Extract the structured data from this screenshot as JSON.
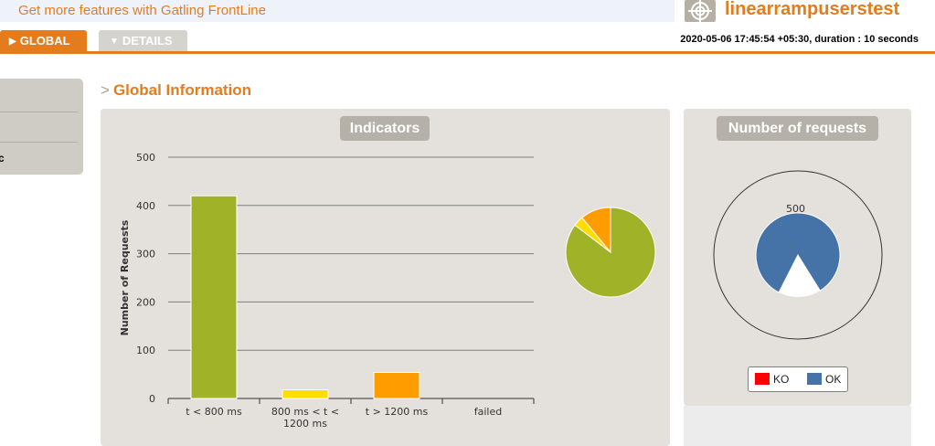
{
  "banner": {
    "text": "Get more features with Gatling FrontLine"
  },
  "header": {
    "logo_icon": "target-icon",
    "simulation_name": "linearrampuserstest",
    "run_info": "2020-05-06 17:45:54 +05:30, duration : 10 seconds"
  },
  "tabs": [
    {
      "label": "GLOBAL",
      "icon": "caret-right-icon",
      "active": true
    },
    {
      "label": "DETAILS",
      "icon": "caret-down-icon",
      "active": false
    }
  ],
  "sidebar": {
    "items": [
      "",
      "",
      "c"
    ]
  },
  "section": {
    "title": "Global Information",
    "marker": ">"
  },
  "indicators": {
    "title": "Indicators",
    "chart_data": {
      "type": "bar",
      "title": "",
      "ylabel": "Number of Requests",
      "xlabel": "",
      "ylim": [
        0,
        500
      ],
      "yticks": [
        "0",
        "100",
        "200",
        "300",
        "400",
        "500"
      ],
      "categories": [
        "t < 800 ms",
        "800 ms < t < 1200 ms",
        "t > 1200 ms",
        "failed"
      ],
      "values": [
        420,
        18,
        54,
        0
      ],
      "colors": [
        "#a0b228",
        "#ffdd00",
        "#ff9d00",
        "#f15b4f"
      ],
      "grid": true
    },
    "pie": {
      "type": "pie",
      "values": [
        420,
        18,
        54,
        0
      ],
      "colors": [
        "#a0b228",
        "#ffdd00",
        "#ff9d00",
        "#f15b4f"
      ]
    }
  },
  "requests": {
    "title": "Number of requests",
    "chart_data": {
      "type": "gauge",
      "series": [
        {
          "name": "OK",
          "value": 492,
          "color": "#4572a7"
        },
        {
          "name": "KO",
          "value": 0,
          "color": "#ff0000"
        }
      ],
      "max": 500,
      "tick_labels": [
        "500",
        "0"
      ]
    },
    "legend": [
      {
        "label": "KO",
        "color": "#ff0000"
      },
      {
        "label": "OK",
        "color": "#4572a7"
      }
    ]
  }
}
